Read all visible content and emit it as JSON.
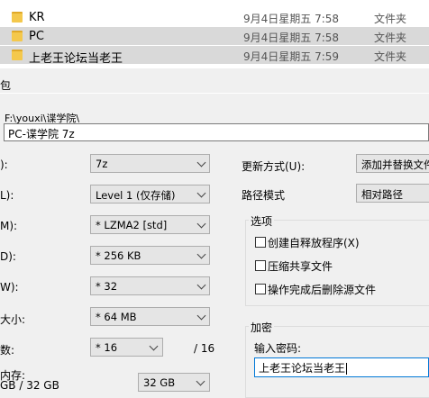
{
  "files": [
    {
      "name": "KR",
      "date": "9月4日星期五 7:58",
      "type": "文件夹",
      "selected": false
    },
    {
      "name": "PC",
      "date": "9月4日星期五 7:58",
      "type": "文件夹",
      "selected": true
    },
    {
      "name": "上老王论坛当老王",
      "date": "9月4日星期五 7:59",
      "type": "文件夹",
      "selected": true
    }
  ],
  "dialog": {
    "title_fragment": "包",
    "path": "F:\\youxi\\谍学院\\",
    "archive_name": "PC-谍学院 7z"
  },
  "left": {
    "labels": {
      "format": "):",
      "level": "L):",
      "method": "M):",
      "dict": "D):",
      "word": "W):",
      "solid": "大小:",
      "threads": "数:",
      "memory": "内存:",
      "memory_value": "GB / 32 GB"
    },
    "format_value": "7z",
    "level_value": "Level 1 (仅存储)",
    "method_value": "* LZMA2 [std]",
    "dict_value": "* 256 KB",
    "word_value": "* 32",
    "solid_value": "* 64 MB",
    "threads_value": "* 16",
    "threads_max": "/ 16",
    "memory_select": "32 GB"
  },
  "right": {
    "update_label": "更新方式(U):",
    "update_value": "添加并替换文件",
    "path_label": "路径模式",
    "path_value": "相对路径",
    "options_title": "选项",
    "opt_sfx": "创建自释放程序(X)",
    "opt_shared": "压缩共享文件",
    "opt_delete": "操作完成后删除源文件",
    "encrypt_title": "加密",
    "pwd_label": "输入密码:",
    "pwd_value": "上老王论坛当老王"
  },
  "colors": {
    "selection": "#d9d9d9",
    "focus": "#0078d7",
    "folder": "#f4c84c"
  }
}
